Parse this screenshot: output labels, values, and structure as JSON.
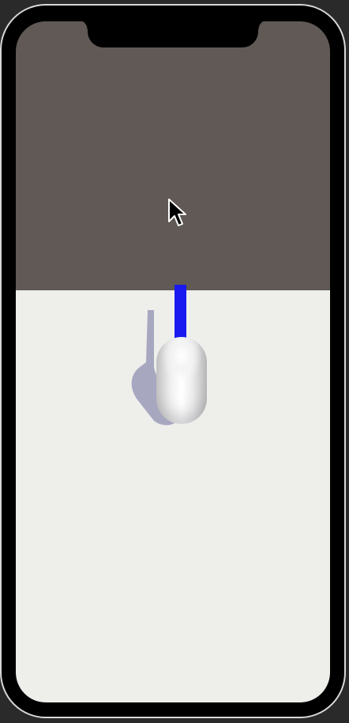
{
  "scene": {
    "colors": {
      "sky": "#605955",
      "ground": "#eeefeb",
      "player": "#f3f3f3",
      "stick": "#1a1af0",
      "shadow": "#9a9ab8"
    },
    "objects": {
      "player_shape": "capsule",
      "direction_indicator": "blue-bar",
      "cursor_icon": "arrow-cursor-icon"
    }
  }
}
